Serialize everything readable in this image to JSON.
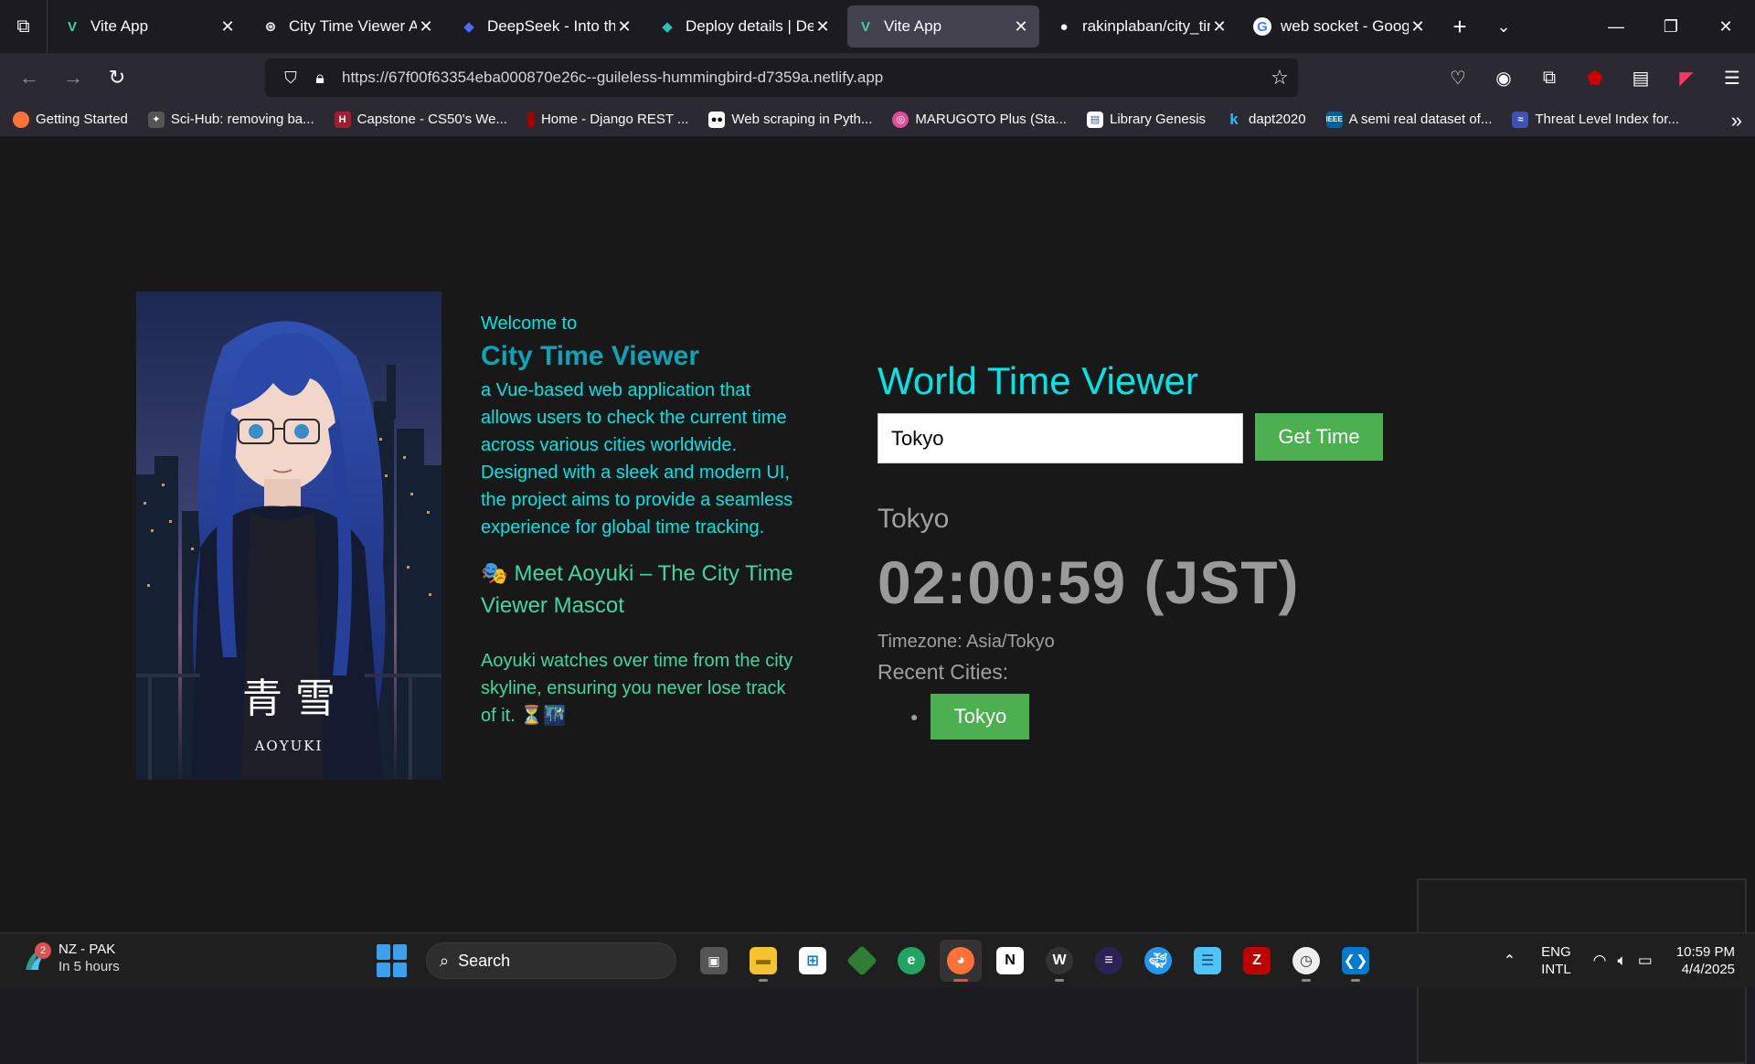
{
  "browser": {
    "tabs": [
      {
        "title": "Vite App",
        "icon": "vite-icon",
        "active": false
      },
      {
        "title": "City Time Viewer App",
        "icon": "openai-icon",
        "active": false
      },
      {
        "title": "DeepSeek - Into the Unknown",
        "icon": "deepseek-icon",
        "active": false
      },
      {
        "title": "Deploy details | Deploys",
        "icon": "netlify-icon",
        "active": false
      },
      {
        "title": "Vite App",
        "icon": "vite-icon",
        "active": true
      },
      {
        "title": "rakinplaban/city_time",
        "icon": "github-icon",
        "active": false
      },
      {
        "title": "web socket - Google Search",
        "icon": "google-icon",
        "active": false
      }
    ],
    "url": "https://67f00f63354eba000870e26c--guileless-hummingbird-d7359a.netlify.app",
    "bookmarks": [
      {
        "label": "Getting Started",
        "color": "#ff7139"
      },
      {
        "label": "Sci-Hub: removing ba...",
        "color": "#555555"
      },
      {
        "label": "Capstone - CS50's We...",
        "color": "#a51c30"
      },
      {
        "label": "Home - Django REST ...",
        "color": "#a30000"
      },
      {
        "label": "Web scraping in Pyth...",
        "color": "#000000"
      },
      {
        "label": "MARUGOTO Plus (Sta...",
        "color": "#e04c9a"
      },
      {
        "label": "Library Genesis",
        "color": "#3a5ba0"
      },
      {
        "label": "dapt2020",
        "color": "#1e88e5"
      },
      {
        "label": "A semi real dataset of...",
        "color": "#00629b"
      },
      {
        "label": "Threat Level Index for...",
        "color": "#3f51b5"
      }
    ]
  },
  "page": {
    "intro": {
      "welcome": "Welcome to",
      "app_name": "City Time Viewer",
      "description": "a Vue-based web application that allows users to check the current time across various cities worldwide. Designed with a sleek and modern UI, the project aims to provide a seamless experience for global time tracking.",
      "meet": "🎭 Meet Aoyuki – The City Time Viewer Mascot",
      "watch": "Aoyuki watches over time from the city skyline, ensuring you never lose track of it. ⏳🌃"
    },
    "mascot": {
      "kanji": "青 雪",
      "name": "AOYUKI"
    },
    "viewer": {
      "heading": "World Time Viewer",
      "input_value": "Tokyo",
      "button_label": "Get Time",
      "result_city": "Tokyo",
      "result_time": "02:00:59 (JST)",
      "timezone": "Timezone: Asia/Tokyo",
      "recent_label": "Recent Cities:",
      "recent_cities": [
        "Tokyo"
      ]
    }
  },
  "taskbar": {
    "weather_title": "NZ - PAK",
    "weather_sub": "In 5 hours",
    "weather_badge": "2",
    "search_label": "Search",
    "lang_top": "ENG",
    "lang_bottom": "INTL",
    "time": "10:59 PM",
    "date": "4/4/2025"
  },
  "colors": {
    "accent_cyan": "#00e5e5",
    "button_green": "#4caf50"
  }
}
